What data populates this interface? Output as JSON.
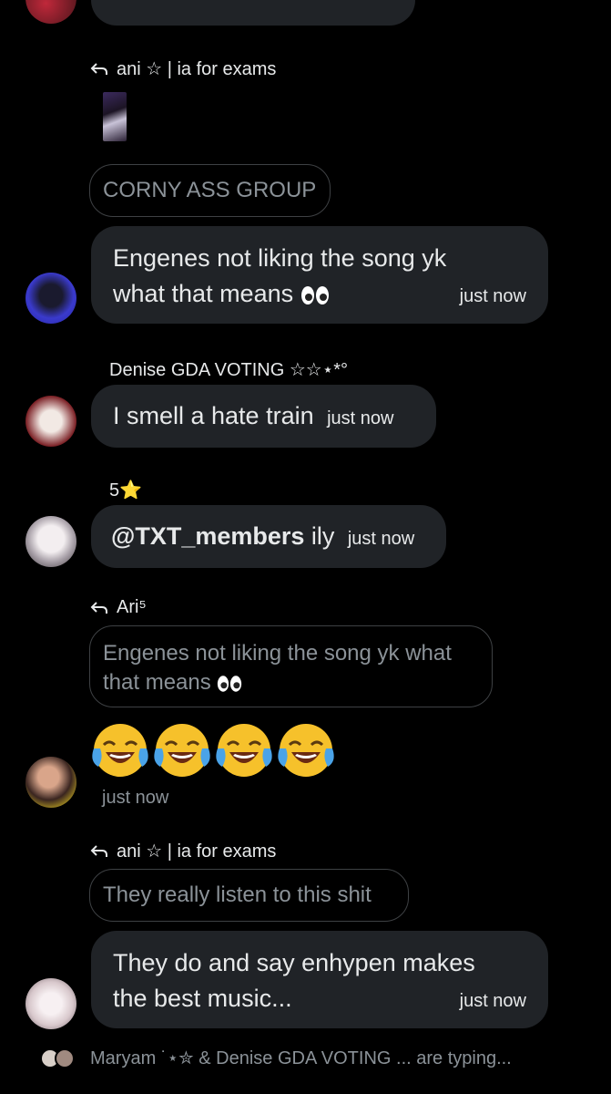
{
  "replies": {
    "reply1": {
      "name": "ani ☆ | ia for exams",
      "quote": "CORNY ASS GROUP"
    },
    "reply2": {
      "name": "Ari⁵",
      "quote_line1": "Engenes not liking the song yk what",
      "quote_line2": "that means"
    },
    "reply3": {
      "name": "ani ☆ | ia for exams",
      "quote": "They really listen to this shit"
    }
  },
  "messages": {
    "m1": {
      "line1": "Engenes not liking the song yk",
      "line2": "what that means",
      "time": "just now"
    },
    "m2": {
      "sender": "Denise GDA VOTING ☆☆⋆*°",
      "text": "I smell a hate train",
      "time": "just now"
    },
    "m3": {
      "sender": "5⭐",
      "mention": "@TXT_members",
      "text": " ily",
      "time": "just now"
    },
    "m4": {
      "time": "just now"
    },
    "m5": {
      "line1": "They do and say enhypen makes",
      "line2": "the best music...",
      "time": "just now"
    }
  },
  "typing": {
    "text": "Maryam ˙⋆✮ & Denise GDA VOTING ... are typing..."
  },
  "colors": {
    "background": "#000000",
    "bubble": "#202327",
    "muted": "#8b9298",
    "emoji_yellow": "#f6c12b",
    "tear_blue": "#4aa3e8"
  },
  "icons": [
    "reply-arrow-icon",
    "laughing-crying-emoji-icon",
    "eyes-emoji-icon"
  ]
}
